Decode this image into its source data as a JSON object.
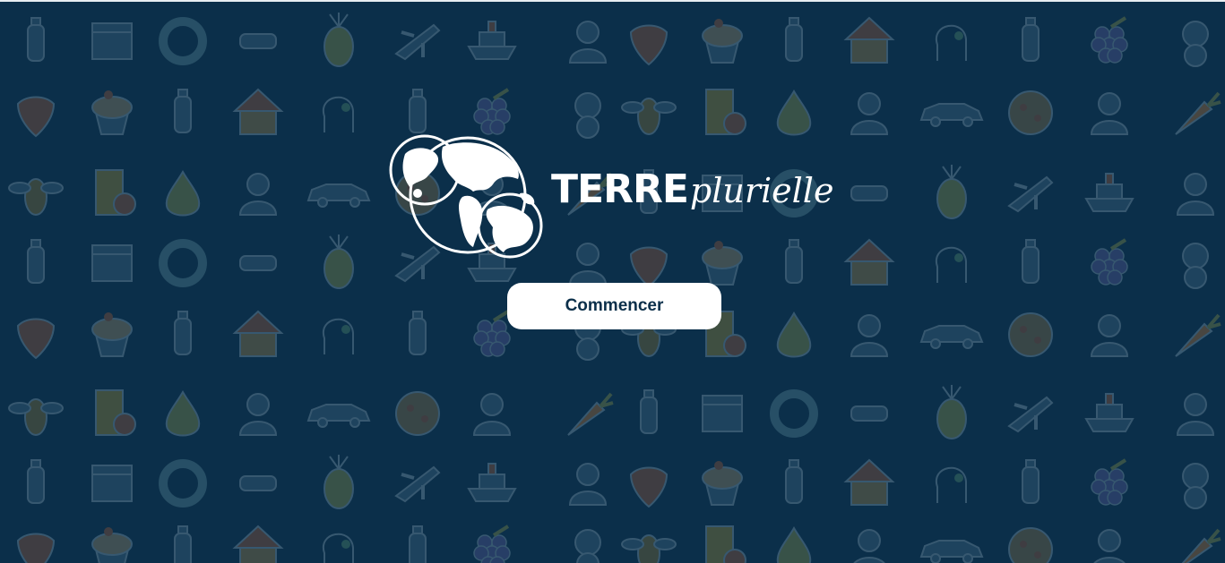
{
  "brand": {
    "name_bold": "TERRE",
    "name_script": "plurielle"
  },
  "actions": {
    "start_label": "Commencer"
  },
  "theme": {
    "background": "#0b2f4a",
    "button_bg": "#ffffff",
    "button_text": "#0b2f4a"
  },
  "background_icons": [
    "water-bottle-icon",
    "clapperboard-icon",
    "color-wheel-icon",
    "pointing-hand-icon",
    "pineapple-icon",
    "airplane-icon",
    "cruise-ship-icon",
    "man-waving-icon",
    "strawberry-icon",
    "cupcake-icon",
    "water-bottle-icon",
    "house-icon",
    "head-gears-icon",
    "soda-bottle-icon",
    "grapes-icon",
    "cat-icon",
    "bee-icon",
    "juice-glass-icon",
    "pear-icon",
    "woman-baby-icon",
    "car-icon",
    "pizza-icon",
    "doctor-icon",
    "carrot-icon"
  ]
}
